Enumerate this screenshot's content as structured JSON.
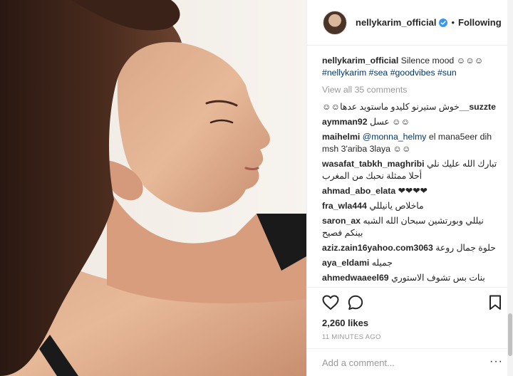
{
  "post": {
    "username": "nellykarim_official",
    "follow_status": "Following",
    "separator": "•",
    "caption_text": "Silence mood ☺☺☺",
    "hashtags": [
      "#nellykarim",
      "#sea",
      "#goodvibes",
      "#sun"
    ],
    "view_all": "View all 35 comments",
    "likes": "2,260 likes",
    "timestamp": "11 MINUTES AGO",
    "add_comment_placeholder": "Add a comment...",
    "more_glyph": "···"
  },
  "comments": [
    {
      "user": "__suzzte",
      "text": "خوش ستيرنو كليدو ماستويد عدها☺☺",
      "rtl": true,
      "user_after": true
    },
    {
      "user": "aymman92",
      "text": "عسل ☺☺"
    },
    {
      "user": "maihelmi",
      "mention": "@monna_helmy",
      "text": "el mana5eer dih msh 3'ariba 3laya ☺☺"
    },
    {
      "user": "wasafat_tabkh_maghribi",
      "text": "تبارك الله عليك نلي أحلا ممثلة نحبك من المغرب"
    },
    {
      "user": "ahmad_abo_elata",
      "text": "❤❤❤❤"
    },
    {
      "user": "fra_wla444",
      "text": "ماخلاص يانيللي"
    },
    {
      "user": "saron_ax",
      "text": "نيللي وبورتشين سبحان الله الشبه بينكم فصيح"
    },
    {
      "user": "aziz.zain16yahoo.com3063",
      "text": "حلوة جمال روعة"
    },
    {
      "user": "aya_eldami",
      "text": "جميله"
    },
    {
      "user": "ahmedwaaeel69",
      "text": "بنات بس تشوف الاستوري عندي ❤"
    }
  ],
  "icons": {
    "heart": "heart-icon",
    "comment": "comment-bubble-icon",
    "bookmark": "bookmark-icon",
    "verified": "verified-badge-icon"
  },
  "colors": {
    "link": "#003569",
    "muted": "#999999",
    "verified": "#3897f0",
    "text": "#262626"
  }
}
